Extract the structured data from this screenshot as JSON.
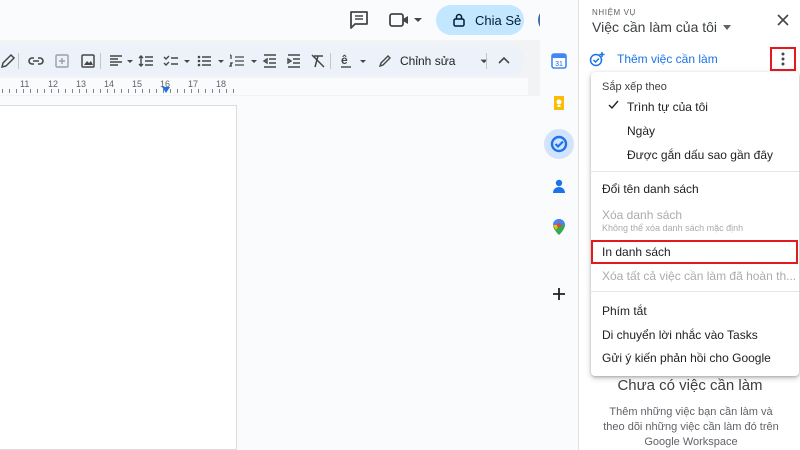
{
  "header": {
    "share_label": "Chia Sẻ",
    "icons": [
      "comment-icon",
      "video-call-icon",
      "lock-icon",
      "avatar"
    ]
  },
  "toolbar": {
    "icons": [
      "pencil-icon",
      "link-icon",
      "add-comment-icon",
      "image-icon",
      "align-icon",
      "line-spacing-icon",
      "checklist-icon",
      "bulleted-list-icon",
      "numbered-list-icon",
      "decrease-indent-icon",
      "increase-indent-icon",
      "clear-formatting-icon",
      "spellcheck-icon",
      "edit-mode-icon",
      "collapse-icon"
    ],
    "edit_mode_label": "Chỉnh sửa"
  },
  "ruler": {
    "numbers": [
      "11",
      "12",
      "13",
      "14",
      "15",
      "16",
      "17",
      "18"
    ]
  },
  "rail": {
    "icons": [
      "calendar-icon",
      "keep-icon",
      "tasks-icon",
      "contacts-icon",
      "maps-icon",
      "add-icon"
    ],
    "calendar_day": "31"
  },
  "tasks_panel": {
    "caption": "NHIỆM VỤ",
    "title": "Việc cần làm của tôi",
    "add_task_label": "Thêm việc cần làm",
    "empty_title": "Chưa có việc cần làm",
    "empty_description": "Thêm những việc bạn cần làm và theo dõi những việc cần làm đó trên Google Workspace"
  },
  "menu": {
    "sort_header": "Sắp xếp theo",
    "sort_options": [
      "Trình tự của tôi",
      "Ngày",
      "Được gắn dấu sao gần đây"
    ],
    "selected_sort": "Trình tự của tôi",
    "rename_list": "Đổi tên danh sách",
    "delete_list": "Xóa danh sách",
    "delete_list_hint": "Không thể xóa danh sách mặc định",
    "print_list": "In danh sách",
    "clear_completed": "Xóa tất cả việc cần làm đã hoàn th...",
    "shortcuts": "Phím tắt",
    "move_reminders": "Di chuyển lời nhắc vào Tasks",
    "send_feedback": "Gửi ý kiến phản hồi cho Google"
  },
  "colors": {
    "accent_blue": "#1a73e8",
    "highlight_red": "#e3191c",
    "share_button_bg": "#c2e7ff",
    "toolbar_bg": "#edf2fa"
  }
}
